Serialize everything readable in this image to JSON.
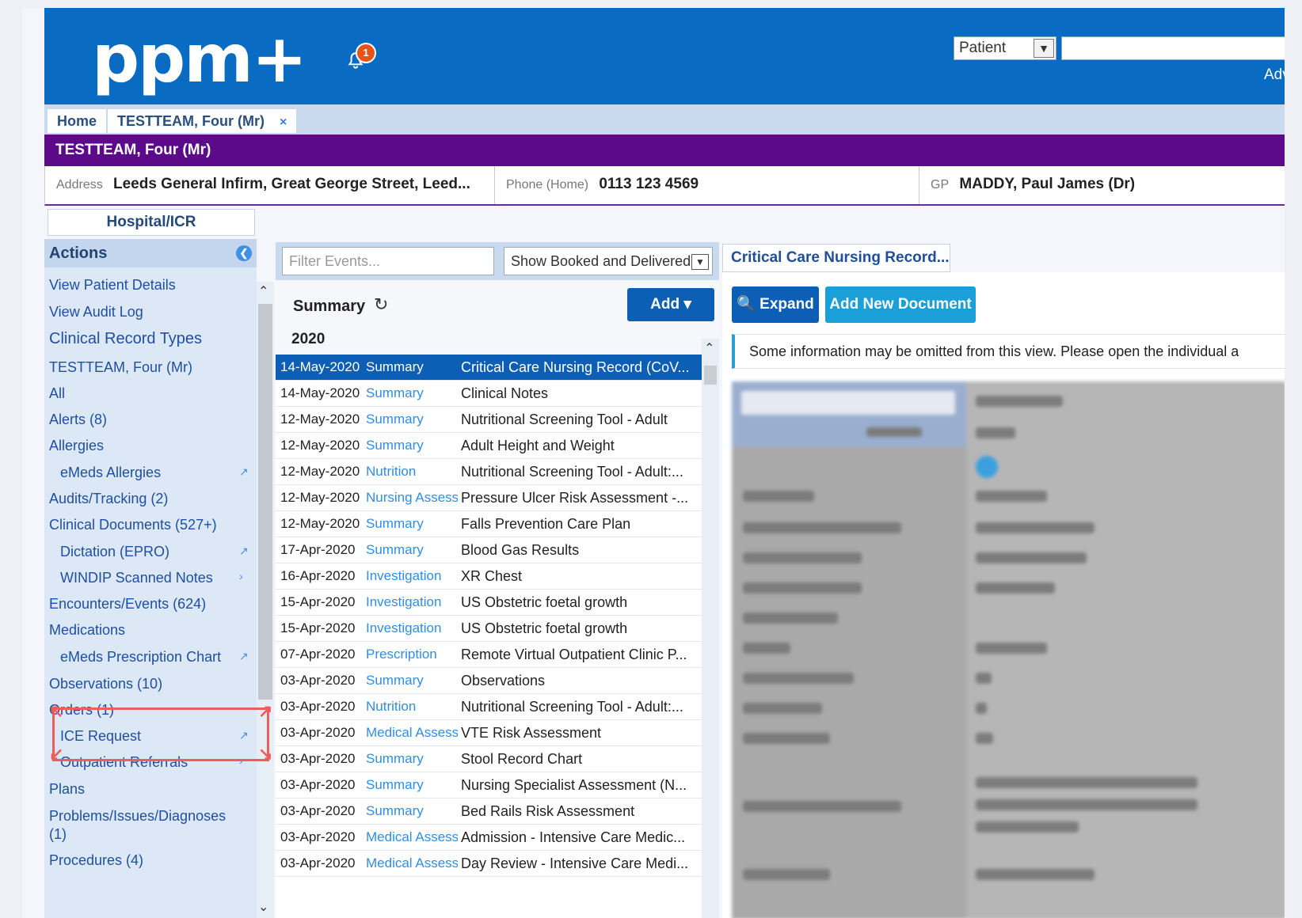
{
  "header": {
    "logo": "ppm+",
    "notification_count": "1",
    "search_type": "Patient",
    "advanced_link": "Advan"
  },
  "tabs": {
    "home": "Home",
    "patient": "TESTTEAM, Four (Mr)",
    "close": "×"
  },
  "banner": {
    "name": "TESTTEAM, Four (Mr)"
  },
  "demographics": {
    "address_label": "Address",
    "address_value": "Leeds General Infirm, Great George Street, Leed...",
    "phone_label": "Phone (Home)",
    "phone_value": "0113 123 4569",
    "gp_label": "GP",
    "gp_value": "MADDY, Paul James (Dr)"
  },
  "left_nav": {
    "tab": "Hospital/ICR",
    "actions_title": "Actions",
    "items": [
      {
        "label": "View Patient Details"
      },
      {
        "label": "View Audit Log"
      },
      {
        "label": "Clinical Record Types"
      },
      {
        "label": "TESTTEAM, Four (Mr)"
      },
      {
        "label": "All"
      },
      {
        "label": "Alerts (8)"
      },
      {
        "label": "Allergies"
      },
      {
        "label": "eMeds Allergies"
      },
      {
        "label": "Audits/Tracking (2)"
      },
      {
        "label": "Clinical Documents (527+)"
      },
      {
        "label": "Dictation (EPRO)"
      },
      {
        "label": "WINDIP Scanned Notes"
      },
      {
        "label": "Encounters/Events (624)"
      },
      {
        "label": "Medications"
      },
      {
        "label": "eMeds Prescription Chart"
      },
      {
        "label": "Observations (10)"
      },
      {
        "label": "Orders (1)"
      },
      {
        "label": "ICE Request"
      },
      {
        "label": "Outpatient Referrals"
      },
      {
        "label": "Plans"
      },
      {
        "label": "Problems/Issues/Diagnoses"
      },
      {
        "label": "(1)"
      },
      {
        "label": "Procedures (4)"
      }
    ]
  },
  "events": {
    "filter_placeholder": "Filter Events...",
    "show_option": "Show Booked and Delivered",
    "summary_label": "Summary",
    "add_label": "Add ▾",
    "year": "2020",
    "rows": [
      {
        "date": "14-May-2020",
        "category": "Summary",
        "title": "Critical Care Nursing Record (CoV..."
      },
      {
        "date": "14-May-2020",
        "category": "Summary",
        "title": "Clinical Notes"
      },
      {
        "date": "12-May-2020",
        "category": "Summary",
        "title": "Nutritional Screening Tool - Adult"
      },
      {
        "date": "12-May-2020",
        "category": "Summary",
        "title": "Adult Height and Weight"
      },
      {
        "date": "12-May-2020",
        "category": "Nutrition",
        "title": "Nutritional Screening Tool - Adult:..."
      },
      {
        "date": "12-May-2020",
        "category": "Nursing Assess",
        "title": "Pressure Ulcer Risk Assessment -..."
      },
      {
        "date": "12-May-2020",
        "category": "Summary",
        "title": "Falls Prevention Care Plan"
      },
      {
        "date": "17-Apr-2020",
        "category": "Summary",
        "title": "Blood Gas Results"
      },
      {
        "date": "16-Apr-2020",
        "category": "Investigation",
        "title": "XR Chest"
      },
      {
        "date": "15-Apr-2020",
        "category": "Investigation",
        "title": "US Obstetric foetal growth"
      },
      {
        "date": "15-Apr-2020",
        "category": "Investigation",
        "title": "US Obstetric foetal growth"
      },
      {
        "date": "07-Apr-2020",
        "category": "Prescription",
        "title": "Remote Virtual Outpatient Clinic P..."
      },
      {
        "date": "03-Apr-2020",
        "category": "Summary",
        "title": "Observations"
      },
      {
        "date": "03-Apr-2020",
        "category": "Nutrition",
        "title": "Nutritional Screening Tool - Adult:..."
      },
      {
        "date": "03-Apr-2020",
        "category": "Medical Assess",
        "title": "VTE Risk Assessment"
      },
      {
        "date": "03-Apr-2020",
        "category": "Summary",
        "title": "Stool Record Chart"
      },
      {
        "date": "03-Apr-2020",
        "category": "Summary",
        "title": "Nursing Specialist Assessment (N..."
      },
      {
        "date": "03-Apr-2020",
        "category": "Summary",
        "title": "Bed Rails Risk Assessment"
      },
      {
        "date": "03-Apr-2020",
        "category": "Medical Assess",
        "title": "Admission - Intensive Care Medic..."
      },
      {
        "date": "03-Apr-2020",
        "category": "Medical Assess",
        "title": "Day Review - Intensive Care Medi..."
      }
    ]
  },
  "document": {
    "tab": "Critical Care Nursing Record...",
    "expand_label": "Expand",
    "add_new_label": "Add New Document",
    "info_text": "Some information may be omitted from this view. Please open the individual a"
  },
  "colors": {
    "header_blue": "#0a6bc2",
    "banner_purple": "#5c0a8a",
    "selected_row": "#0d5fb6",
    "link_blue": "#2f8de4",
    "highlight_red": "#ef5c5c"
  }
}
